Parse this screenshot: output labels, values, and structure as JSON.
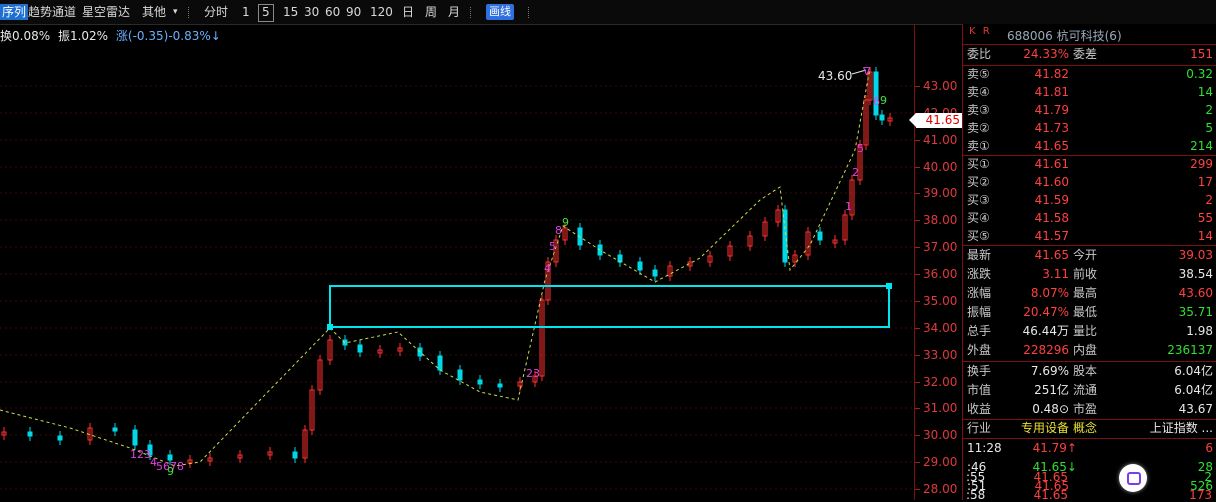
{
  "toolbar": {
    "items": [
      "序列",
      "趋势通道",
      "星空雷达",
      "其他",
      "分时",
      "1",
      "5",
      "15",
      "30",
      "60",
      "90",
      "120",
      "日",
      "周",
      "月",
      "画线"
    ]
  },
  "info": {
    "turnover": "换0.08%",
    "amplitude": "振1.02%",
    "change": "涨(-0.35)-0.83%↓"
  },
  "axis": {
    "ticks": [
      "43.00",
      "42.00",
      "41.00",
      "40.00",
      "39.00",
      "38.00",
      "37.00",
      "36.00",
      "35.00",
      "34.00",
      "33.00",
      "32.00",
      "31.00",
      "30.00",
      "29.00",
      "28.00"
    ],
    "current_price": "41.65"
  },
  "chart": {
    "high_label": "43.60"
  },
  "panel": {
    "tabs": "K  R",
    "title": "688006 杭可科技(6)",
    "weibi": {
      "label": "委比",
      "value": "24.33%",
      "label2": "委差",
      "value2": "151"
    },
    "sells": [
      {
        "label": "卖⑤",
        "price": "41.82",
        "vol": "0.32"
      },
      {
        "label": "卖④",
        "price": "41.81",
        "vol": "14"
      },
      {
        "label": "卖③",
        "price": "41.79",
        "vol": "2"
      },
      {
        "label": "卖②",
        "price": "41.73",
        "vol": "5"
      },
      {
        "label": "卖①",
        "price": "41.65",
        "vol": "214"
      }
    ],
    "buys": [
      {
        "label": "买①",
        "price": "41.61",
        "vol": "299"
      },
      {
        "label": "买②",
        "price": "41.60",
        "vol": "17"
      },
      {
        "label": "买③",
        "price": "41.59",
        "vol": "2"
      },
      {
        "label": "买④",
        "price": "41.58",
        "vol": "55"
      },
      {
        "label": "买⑤",
        "price": "41.57",
        "vol": "14"
      }
    ],
    "stats": [
      {
        "l1": "最新",
        "v1": "41.65",
        "l2": "今开",
        "v2": "39.03"
      },
      {
        "l1": "涨跌",
        "v1": "3.11",
        "l2": "前收",
        "v2": "38.54"
      },
      {
        "l1": "涨幅",
        "v1": "8.07%",
        "l2": "最高",
        "v2": "43.60"
      },
      {
        "l1": "振幅",
        "v1": "20.47%",
        "l2": "最低",
        "v2": "35.71"
      },
      {
        "l1": "总手",
        "v1": "46.44万",
        "l2": "量比",
        "v2": "1.98"
      },
      {
        "l1": "外盘",
        "v1": "228296",
        "l2": "内盘",
        "v2": "236137"
      }
    ],
    "fund": [
      {
        "l1": "换手",
        "v1": "7.69%",
        "l2": "股本",
        "v2": "6.04亿"
      },
      {
        "l1": "市值",
        "v1": "251亿",
        "l2": "流通",
        "v2": "6.04亿"
      },
      {
        "l1": "收益",
        "v1": "0.48⊙",
        "l2": "市盈",
        "v2": "43.67"
      }
    ],
    "industry": {
      "l1": "行业",
      "v1": "专用设备",
      "l2": "概念",
      "v2": "上证指数 ..."
    },
    "ticks": [
      {
        "time": "11:28",
        "price": "41.79↑",
        "vol": "6"
      },
      {
        "time": ":46",
        "price": "41.65↓",
        "vol": "28"
      },
      {
        "time": ":51",
        "price": "41.65",
        "vol": "526"
      },
      {
        "time": ":55",
        "price": "41.65",
        "vol": "2"
      },
      {
        "time": ":58",
        "price": "41.65",
        "vol": "173"
      }
    ]
  }
}
